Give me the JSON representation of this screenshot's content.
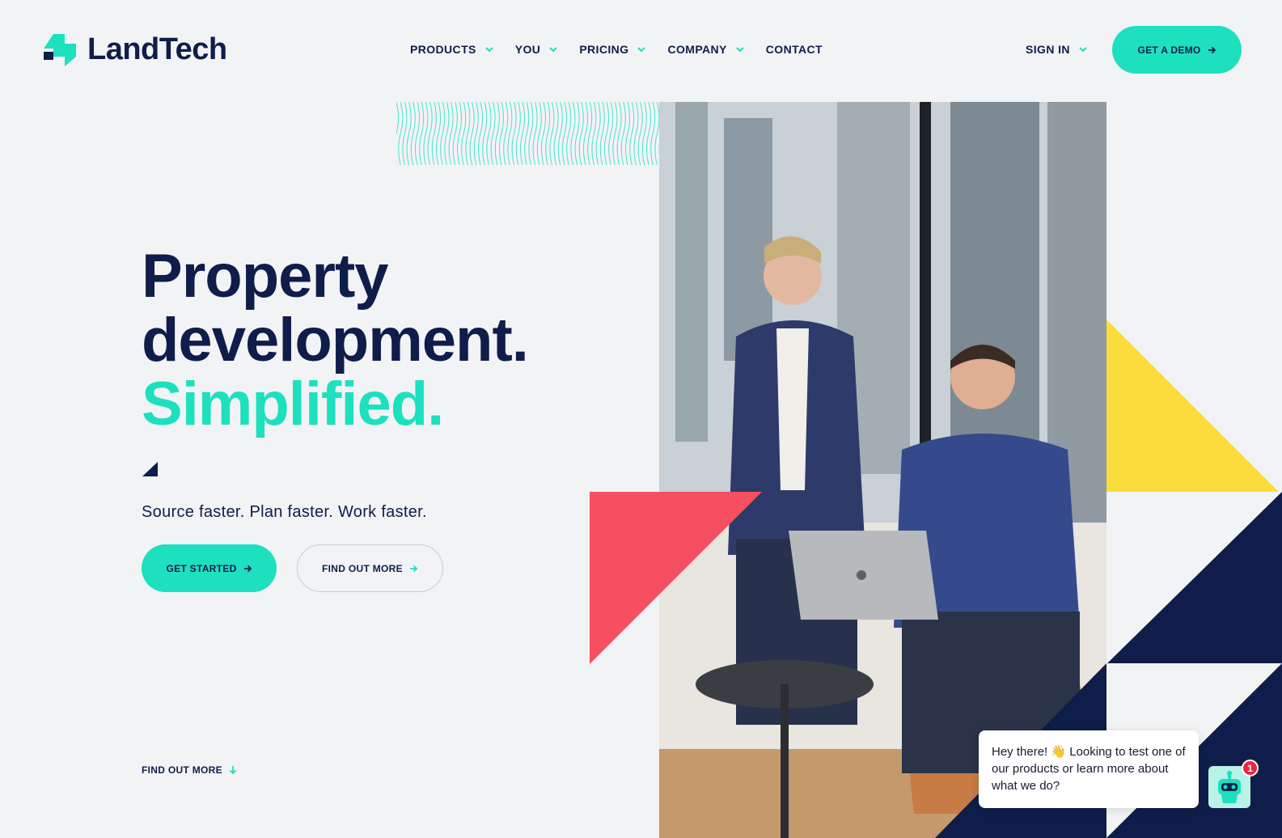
{
  "brand": {
    "name": "LandTech",
    "accent": "#1de0bf",
    "navy": "#0f1d4a",
    "pink": "#f74f62",
    "yellow": "#fadc3c"
  },
  "nav": {
    "items": [
      {
        "label": "PRODUCTS",
        "has_dropdown": true
      },
      {
        "label": "YOU",
        "has_dropdown": true
      },
      {
        "label": "PRICING",
        "has_dropdown": true
      },
      {
        "label": "COMPANY",
        "has_dropdown": true
      },
      {
        "label": "CONTACT",
        "has_dropdown": false
      }
    ],
    "signin_label": "SIGN IN",
    "demo_label": "GET A DEMO"
  },
  "hero": {
    "line1": "Property",
    "line2": "development.",
    "line3": "Simplified.",
    "tagline": "Source faster. Plan faster. Work faster.",
    "get_started_label": "GET STARTED",
    "find_out_more_label": "FIND OUT MORE",
    "scroll_label": "FIND OUT MORE"
  },
  "chat": {
    "message": "Hey there! 👋  Looking to test one of our products or learn more about what we do?",
    "unread_count": "1"
  },
  "icons": {
    "logo": "landtech-logo-icon",
    "dropdown": "chevron-down-icon",
    "arrow_right": "arrow-right-icon",
    "arrow_down": "arrow-down-icon",
    "chatbot": "robot-icon"
  }
}
